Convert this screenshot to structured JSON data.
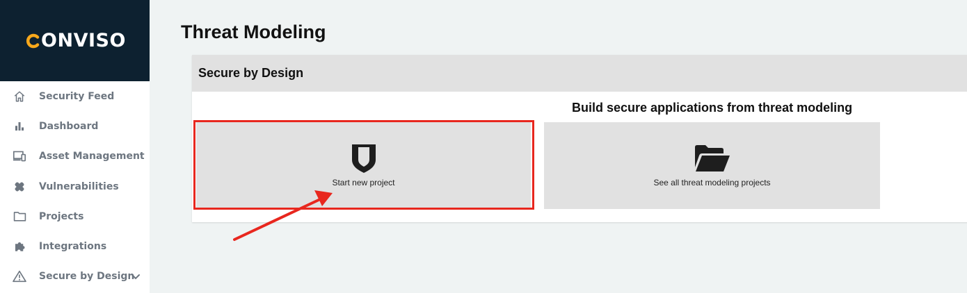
{
  "brand": {
    "name": "ONVISO",
    "accent": "#f7a81b",
    "sidebar_bg": "#0d2130"
  },
  "sidebar": {
    "items": [
      {
        "label": "Security Feed",
        "icon": "home-icon"
      },
      {
        "label": "Dashboard",
        "icon": "bar-chart-icon"
      },
      {
        "label": "Asset Management",
        "icon": "devices-icon"
      },
      {
        "label": "Vulnerabilities",
        "icon": "bandage-icon"
      },
      {
        "label": "Projects",
        "icon": "folder-icon"
      },
      {
        "label": "Integrations",
        "icon": "puzzle-icon"
      },
      {
        "label": "Secure by Design",
        "icon": "warning-icon",
        "expandable": true
      }
    ]
  },
  "main": {
    "title": "Threat Modeling",
    "panel": {
      "title": "Secure by Design",
      "subtitle": "Build secure applications from threat modeling",
      "cards": [
        {
          "label": "Start new project",
          "icon": "shield-icon"
        },
        {
          "label": "See all threat modeling projects",
          "icon": "folder-open-icon"
        }
      ]
    }
  },
  "annotation": {
    "highlight_color": "#e8271e"
  }
}
